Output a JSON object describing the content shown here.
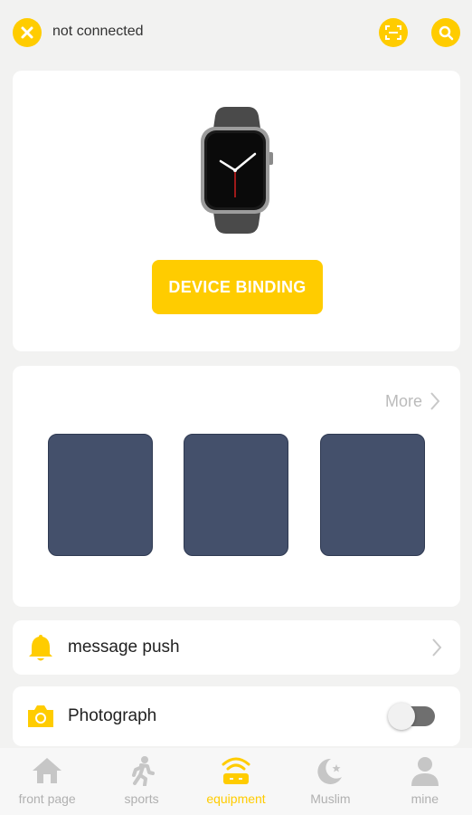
{
  "header": {
    "status": "not connected",
    "icons": [
      "close-icon",
      "scan-icon",
      "search-icon"
    ]
  },
  "device": {
    "bind_label": "DEVICE BINDING",
    "image": "smartwatch-icon"
  },
  "dials": {
    "more_label": "More",
    "count": 3
  },
  "settings": [
    {
      "label": "message push",
      "icon": "bell-icon",
      "control": "arrow"
    },
    {
      "label": "Photograph",
      "icon": "camera-icon",
      "control": "toggle",
      "enabled": false
    }
  ],
  "nav": {
    "items": [
      {
        "label": "front page",
        "icon": "home-icon",
        "active": false
      },
      {
        "label": "sports",
        "icon": "running-icon",
        "active": false
      },
      {
        "label": "equipment",
        "icon": "device-icon",
        "active": true
      },
      {
        "label": "Muslim",
        "icon": "moon-star-icon",
        "active": false
      },
      {
        "label": "mine",
        "icon": "user-icon",
        "active": false
      }
    ]
  },
  "colors": {
    "accent": "#ffcc00",
    "background": "#f2f2f1",
    "dial": "#44506b",
    "inactive": "#b0b0b0"
  }
}
